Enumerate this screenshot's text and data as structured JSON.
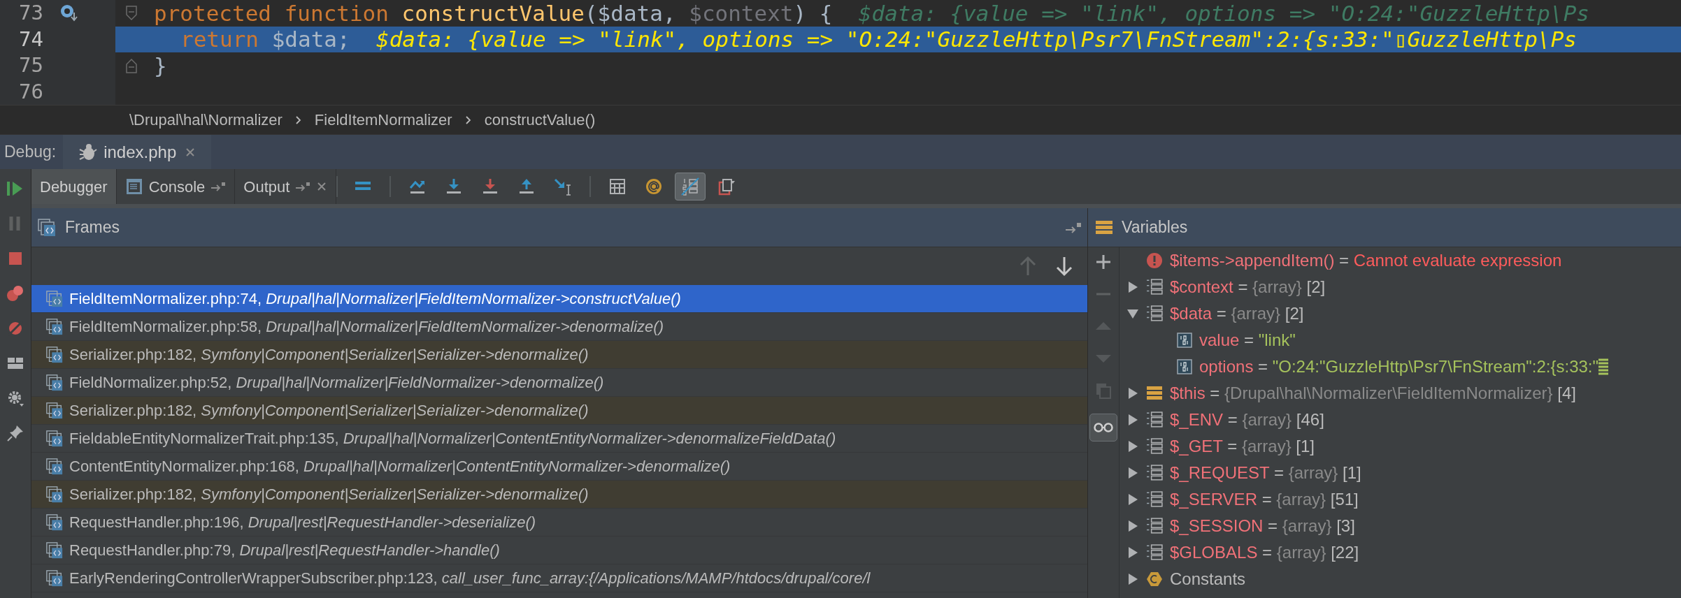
{
  "editor": {
    "lines": [
      {
        "number": "73",
        "current": false,
        "gutter_icon": true,
        "fold_start": true,
        "fold_end": false,
        "indented": false,
        "tokens": [
          {
            "kind": "keyword",
            "text": "protected function "
          },
          {
            "kind": "function",
            "text": "constructValue"
          },
          {
            "kind": "plain",
            "text": "($data, "
          },
          {
            "kind": "unused",
            "text": "$context"
          },
          {
            "kind": "plain",
            "text": ") {  "
          },
          {
            "kind": "hint",
            "text": "$data: {value => \"link\", options => \"O:24:\"GuzzleHttp\\Ps"
          }
        ]
      },
      {
        "number": "74",
        "current": true,
        "gutter_icon": false,
        "fold_start": false,
        "fold_end": false,
        "indented": true,
        "tokens": [
          {
            "kind": "keyword",
            "text": "return"
          },
          {
            "kind": "plain",
            "text": " $data;  "
          },
          {
            "kind": "hint",
            "text": "$data: {value => \"link\", options => \"O:24:\"GuzzleHttp\\Psr7\\FnStream\":2:{s:33:\"▯GuzzleHttp\\Ps"
          }
        ]
      },
      {
        "number": "75",
        "current": false,
        "gutter_icon": false,
        "fold_start": false,
        "fold_end": true,
        "indented": false,
        "tokens": [
          {
            "kind": "plain",
            "text": "}"
          }
        ]
      },
      {
        "number": "76",
        "current": false,
        "gutter_icon": false,
        "fold_start": false,
        "fold_end": false
      }
    ]
  },
  "breadcrumb": [
    "\\Drupal\\hal\\Normalizer",
    "FieldItemNormalizer",
    "constructValue()"
  ],
  "debug_bar": {
    "label": "Debug:",
    "tab": "index.php"
  },
  "toolbar": {
    "tabs": [
      {
        "label": "Debugger",
        "selected": true,
        "console_icon": false,
        "pin": false,
        "closable": false
      },
      {
        "label": "Console",
        "selected": false,
        "console_icon": true,
        "pin": true,
        "closable": false
      },
      {
        "label": "Output",
        "selected": false,
        "console_icon": false,
        "pin": true,
        "closable": true
      }
    ],
    "groups": [
      [
        {
          "kind": "show_frames",
          "on": false
        }
      ],
      [
        {
          "kind": "step_over",
          "on": false
        },
        {
          "kind": "step_into",
          "on": false
        },
        {
          "kind": "force_step_into",
          "on": false
        },
        {
          "kind": "step_out",
          "on": false
        },
        {
          "kind": "run_to_cursor",
          "on": false
        }
      ],
      [
        {
          "kind": "evaluate",
          "on": false
        },
        {
          "kind": "watch",
          "on": false
        },
        {
          "kind": "inline_values",
          "on": true
        },
        {
          "kind": "restore_layout",
          "on": false
        }
      ]
    ]
  },
  "frames": {
    "title": "Frames",
    "items": [
      {
        "file": "FieldItemNormalizer.php:74,",
        "location": "Drupal|hal|Normalizer|FieldItemNormalizer->constructValue()",
        "selected": true,
        "library": false
      },
      {
        "file": "FieldItemNormalizer.php:58,",
        "location": "Drupal|hal|Normalizer|FieldItemNormalizer->denormalize()",
        "selected": false,
        "library": false
      },
      {
        "file": "Serializer.php:182,",
        "location": "Symfony|Component|Serializer|Serializer->denormalize()",
        "selected": false,
        "library": true
      },
      {
        "file": "FieldNormalizer.php:52,",
        "location": "Drupal|hal|Normalizer|FieldNormalizer->denormalize()",
        "selected": false,
        "library": false
      },
      {
        "file": "Serializer.php:182,",
        "location": "Symfony|Component|Serializer|Serializer->denormalize()",
        "selected": false,
        "library": true
      },
      {
        "file": "FieldableEntityNormalizerTrait.php:135,",
        "location": "Drupal|hal|Normalizer|ContentEntityNormalizer->denormalizeFieldData()",
        "selected": false,
        "library": false
      },
      {
        "file": "ContentEntityNormalizer.php:168,",
        "location": "Drupal|hal|Normalizer|ContentEntityNormalizer->denormalize()",
        "selected": false,
        "library": false
      },
      {
        "file": "Serializer.php:182,",
        "location": "Symfony|Component|Serializer|Serializer->denormalize()",
        "selected": false,
        "library": true
      },
      {
        "file": "RequestHandler.php:196,",
        "location": "Drupal|rest|RequestHandler->deserialize()",
        "selected": false,
        "library": false
      },
      {
        "file": "RequestHandler.php:79,",
        "location": "Drupal|rest|RequestHandler->handle()",
        "selected": false,
        "library": false
      },
      {
        "file": "EarlyRenderingControllerWrapperSubscriber.php:123,",
        "location": "call_user_func_array:{/Applications/MAMP/htdocs/drupal/core/l",
        "selected": false,
        "library": false
      }
    ]
  },
  "variables": {
    "title": "Variables",
    "items": [
      {
        "kind": "error",
        "name": "$items->appendItem()",
        "equals": "=",
        "value": "Cannot evaluate expression"
      },
      {
        "kind": "array",
        "expanded": false,
        "name": "$context",
        "equals": "=",
        "type": "{array}",
        "count": "[2]"
      },
      {
        "kind": "array",
        "expanded": true,
        "name": "$data",
        "equals": "=",
        "type": "{array}",
        "count": "[2]",
        "children": [
          {
            "kind": "field",
            "name": "value",
            "equals": "=",
            "value": "\"link\""
          },
          {
            "kind": "field",
            "name": "options",
            "equals": "=",
            "value": "\"O:24:\"GuzzleHttp\\Psr7\\FnStream\":2:{s:33:\"",
            "more": true
          }
        ]
      },
      {
        "kind": "object",
        "expanded": false,
        "name": "$this",
        "equals": "=",
        "type": "{Drupal\\hal\\Normalizer\\FieldItemNormalizer}",
        "count": "[4]"
      },
      {
        "kind": "array",
        "expanded": false,
        "name": "$_ENV",
        "equals": "=",
        "type": "{array}",
        "count": "[46]"
      },
      {
        "kind": "array",
        "expanded": false,
        "name": "$_GET",
        "equals": "=",
        "type": "{array}",
        "count": "[1]"
      },
      {
        "kind": "array",
        "expanded": false,
        "name": "$_REQUEST",
        "equals": "=",
        "type": "{array}",
        "count": "[1]"
      },
      {
        "kind": "array",
        "expanded": false,
        "name": "$_SERVER",
        "equals": "=",
        "type": "{array}",
        "count": "[51]"
      },
      {
        "kind": "array",
        "expanded": false,
        "name": "$_SESSION",
        "equals": "=",
        "type": "{array}",
        "count": "[3]"
      },
      {
        "kind": "array",
        "expanded": false,
        "name": "$GLOBALS",
        "equals": "=",
        "type": "{array}",
        "count": "[22]"
      },
      {
        "kind": "constants",
        "expanded": false,
        "name": "Constants"
      }
    ]
  }
}
